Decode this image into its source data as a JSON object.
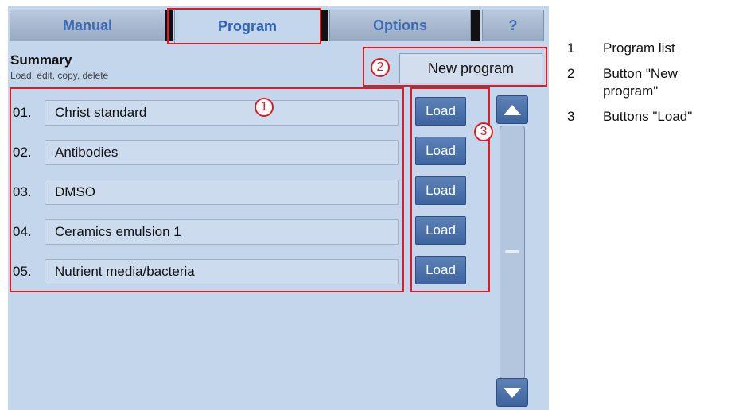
{
  "tabs": [
    {
      "label": "Manual",
      "active": false
    },
    {
      "label": "Program",
      "active": true
    },
    {
      "label": "Options",
      "active": false
    },
    {
      "label": "?",
      "active": false
    }
  ],
  "header": {
    "title": "Summary",
    "subtitle": "Load, edit, copy, delete"
  },
  "new_program_label": "New program",
  "programs": [
    {
      "number": "01.",
      "name": "Christ standard"
    },
    {
      "number": "02.",
      "name": "Antibodies"
    },
    {
      "number": "03.",
      "name": "DMSO"
    },
    {
      "number": "04.",
      "name": "Ceramics emulsion 1"
    },
    {
      "number": "05.",
      "name": "Nutrient media/bacteria"
    }
  ],
  "load_label": "Load",
  "callouts": [
    "1",
    "2",
    "3"
  ],
  "legend": [
    {
      "number": "1",
      "text": "Program list"
    },
    {
      "number": "2",
      "text": "Button \"New program\""
    },
    {
      "number": "3",
      "text": "Buttons \"Load\""
    }
  ],
  "colors": {
    "screen_bg": "#c4d6ec",
    "tab_text": "#3d6bb3",
    "load_button": "#4a6fa8",
    "annotation": "#e21b23"
  },
  "icons": {
    "scroll_up": "triangle-up-icon",
    "scroll_down": "triangle-down-icon"
  }
}
